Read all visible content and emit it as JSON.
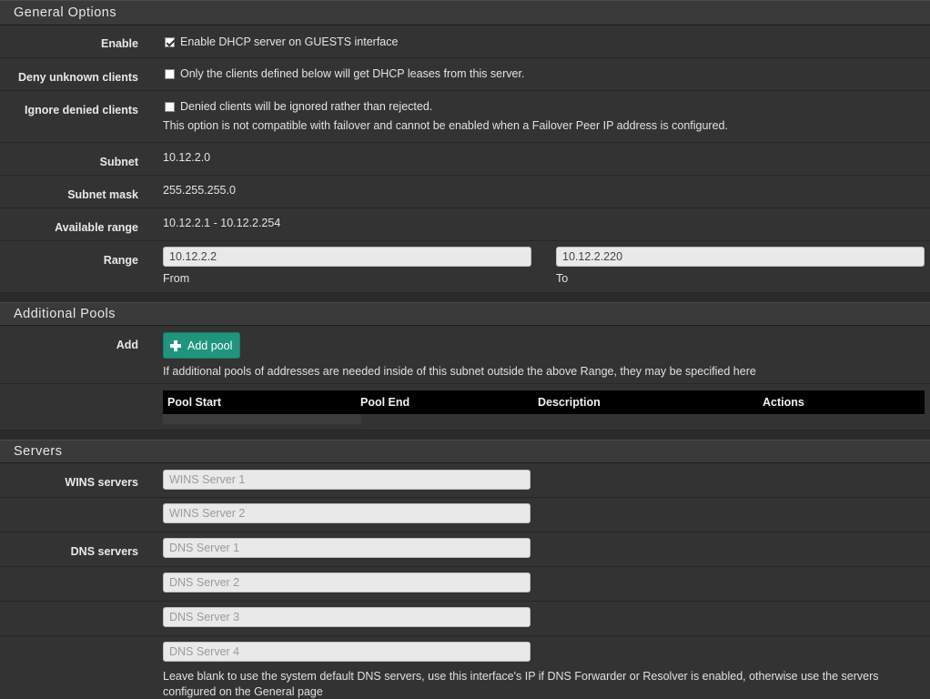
{
  "general": {
    "header": "General Options",
    "enable": {
      "label": "Enable",
      "checked": true,
      "text": "Enable DHCP server on GUESTS interface"
    },
    "deny_unknown": {
      "label": "Deny unknown clients",
      "checked": false,
      "text": "Only the clients defined below will get DHCP leases from this server."
    },
    "ignore_denied": {
      "label": "Ignore denied clients",
      "checked": false,
      "text": "Denied clients will be ignored rather than rejected.",
      "help": "This option is not compatible with failover and cannot be enabled when a Failover Peer IP address is configured."
    },
    "subnet": {
      "label": "Subnet",
      "value": "10.12.2.0"
    },
    "subnet_mask": {
      "label": "Subnet mask",
      "value": "255.255.255.0"
    },
    "available_range": {
      "label": "Available range",
      "value": "10.12.2.1 - 10.12.2.254"
    },
    "range": {
      "label": "Range",
      "from_value": "10.12.2.2",
      "from_label": "From",
      "to_value": "10.12.2.220",
      "to_label": "To"
    }
  },
  "pools": {
    "header": "Additional Pools",
    "add_label": "Add",
    "add_button": "Add pool",
    "help": "If additional pools of addresses are needed inside of this subnet outside the above Range, they may be specified here",
    "columns": [
      "Pool Start",
      "Pool End",
      "Description",
      "Actions"
    ]
  },
  "servers": {
    "header": "Servers",
    "wins_label": "WINS servers",
    "wins": [
      "WINS Server 1",
      "WINS Server 2"
    ],
    "dns_label": "DNS servers",
    "dns": [
      "DNS Server 1",
      "DNS Server 2",
      "DNS Server 3",
      "DNS Server 4"
    ],
    "dns_help": "Leave blank to use the system default DNS servers, use this interface's IP if DNS Forwarder or Resolver is enabled, otherwise use the servers configured on the General page"
  },
  "colors": {
    "accent": "#20957d",
    "background": "#333333",
    "header": "#3a3a3a"
  }
}
